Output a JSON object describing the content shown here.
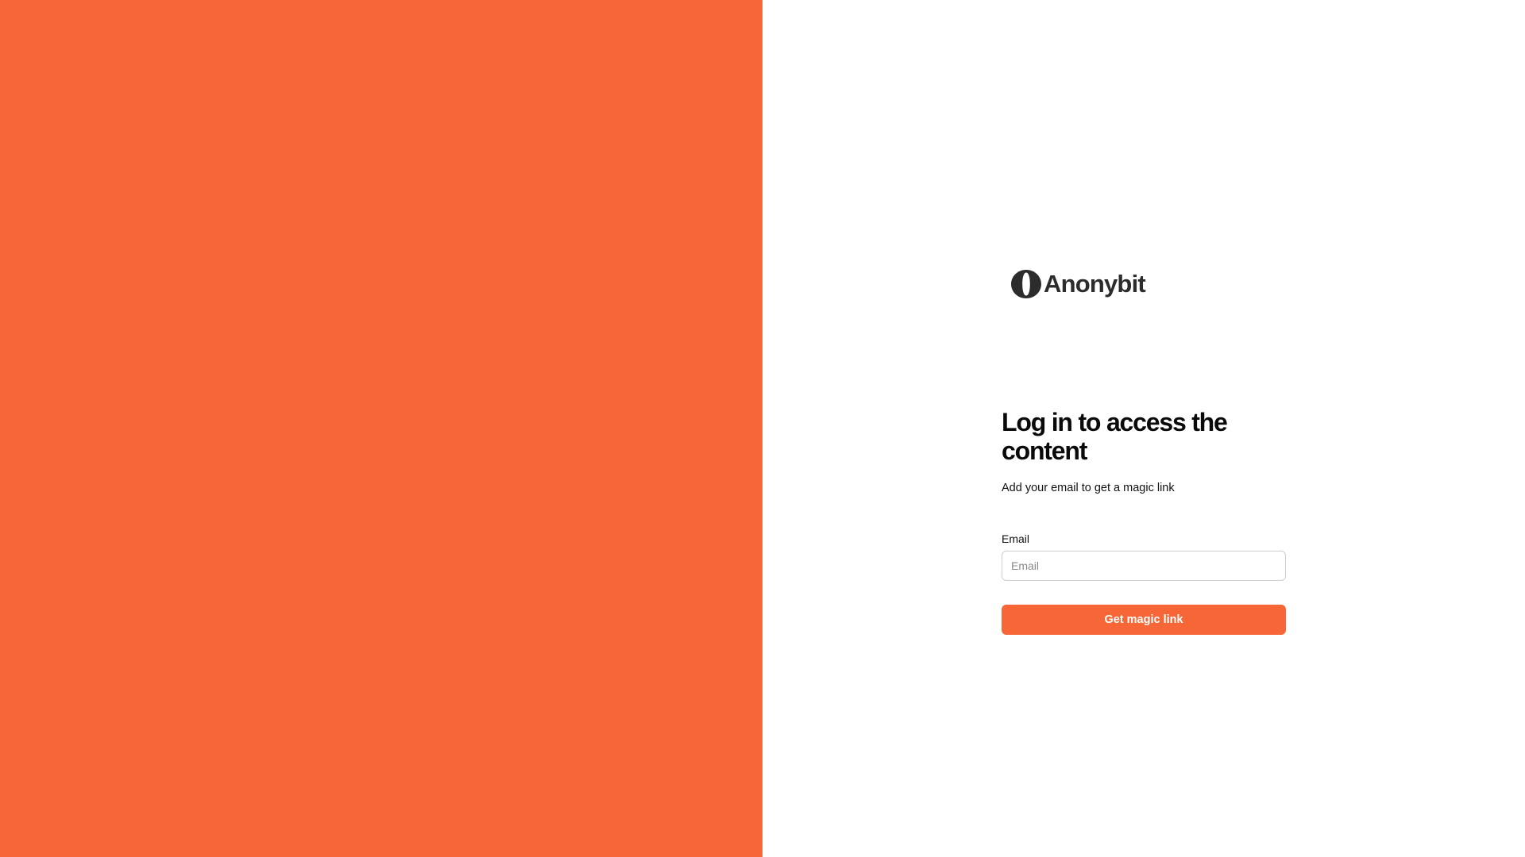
{
  "brand": {
    "name": "Anonybit",
    "logo_icon": "anonybit-logo-icon",
    "accent_color": "#f66637",
    "logo_color": "#2c2c2c"
  },
  "login": {
    "heading": "Log in to access the content",
    "subtitle": "Add your email to get a magic link",
    "email_label": "Email",
    "email_placeholder": "Email",
    "email_value": "",
    "submit_label": "Get magic link"
  }
}
